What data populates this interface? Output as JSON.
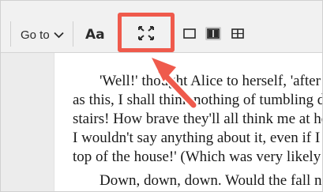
{
  "toolbar": {
    "goto_label": "Go to",
    "text_options_label": "Aa",
    "fullscreen_icon": "fullscreen-icon",
    "single_column_icon": "single-column-icon",
    "two_column_icon": "two-column-icon",
    "two_page_icon": "two-page-icon"
  },
  "book": {
    "lines": [
      "'Well!' thought Alice to herself, 'after such a fall",
      "as this, I shall think nothing of tumbling down",
      "stairs! How brave they'll all think me at home!",
      "I wouldn't say anything about it, even if I fell off the",
      "top of the house!' (Which was very likely true.)",
      "Down, down, down. Would the fall never come to"
    ]
  },
  "colors": {
    "highlight": "#ef5a4c",
    "toolbar_bg": "#f1f1f1",
    "sidebar_bg": "#ececec"
  }
}
